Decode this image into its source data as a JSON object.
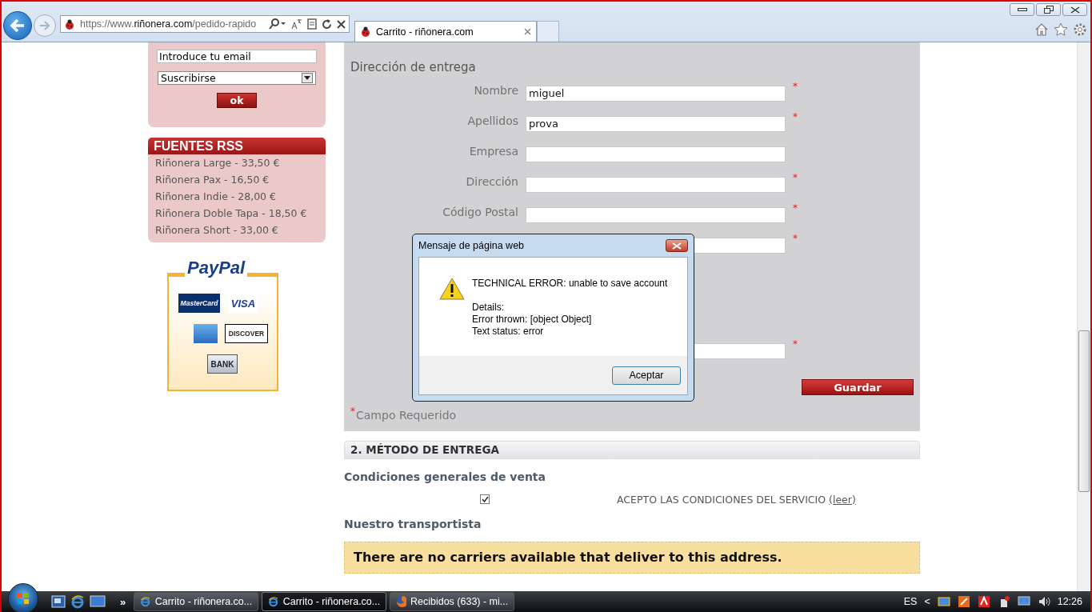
{
  "browser": {
    "address": "https://www.**riñonera.com**/pedido-rapido",
    "tabs": [
      {
        "title": "Carrito - riñonera.com",
        "selected": true
      }
    ]
  },
  "sidebar": {
    "newsletter": {
      "email_value": "Introduce tu email",
      "select_value": "Suscribirse",
      "button": "ok"
    },
    "rss": {
      "title": "FUENTES RSS",
      "items": [
        "Riñonera Large - 33,50 €",
        "Riñonera Pax - 16,50 €",
        "Riñonera Indie - 28,00 €",
        "Riñonera Doble Tapa - 18,50 €",
        "Riñonera Short - 33,00 €"
      ]
    },
    "paypal": {
      "logo": "PayPal",
      "cards": [
        {
          "kind": "mastercard",
          "label": "MasterCard"
        },
        {
          "kind": "visa",
          "label": "VISA"
        },
        {
          "kind": "amex"
        },
        {
          "kind": "discover",
          "label": "DISCOVER"
        },
        {
          "kind": "bank",
          "label": "BANK"
        }
      ]
    }
  },
  "address_form": {
    "title": "Dirección de entrega",
    "fields": [
      {
        "label": "Nombre",
        "value": "miguel",
        "required_mark": "*"
      },
      {
        "label": "Apellidos",
        "value": "prova",
        "required_mark": "*"
      },
      {
        "label": "Empresa"
      },
      {
        "label": "Dirección",
        "required_mark": "*"
      },
      {
        "label": "Código Postal",
        "required_mark": "*"
      },
      {
        "required_mark": "*"
      }
    ],
    "more_fields": [
      {
        "required_mark": "*"
      }
    ],
    "save_button": "Guardar",
    "required_note": {
      "mark": "*",
      "text": "Campo Requerido"
    }
  },
  "delivery": {
    "header": "2. MÉTODO DE ENTREGA",
    "terms_title": "Condiciones generales de venta",
    "terms": {
      "checked": true,
      "text": "ACEPTO LAS CONDICIONES DEL SERVICIO",
      "link": "(leer)"
    },
    "carrier_title": "Nuestro transportista",
    "carrier_notice": "There are no carriers available that deliver to this address."
  },
  "dialog": {
    "title": "Mensaje de página web",
    "message": "TECHNICAL ERROR: unable to save account",
    "details": [
      "Details:",
      "Error thrown: [object Object]",
      "Text status: error"
    ],
    "button": "Aceptar"
  },
  "taskbar": {
    "tasks": [
      {
        "kind": "ie",
        "title": "Carrito - riñonera.co...",
        "selected": false
      },
      {
        "kind": "ie",
        "title": "Carrito - riñonera.co...",
        "selected": true
      },
      {
        "kind": "firefox",
        "title": "Recibidos (633) - mi...",
        "selected": false
      }
    ],
    "more": "»",
    "language": "ES",
    "tray_expand": "<",
    "clock": "12:26"
  }
}
